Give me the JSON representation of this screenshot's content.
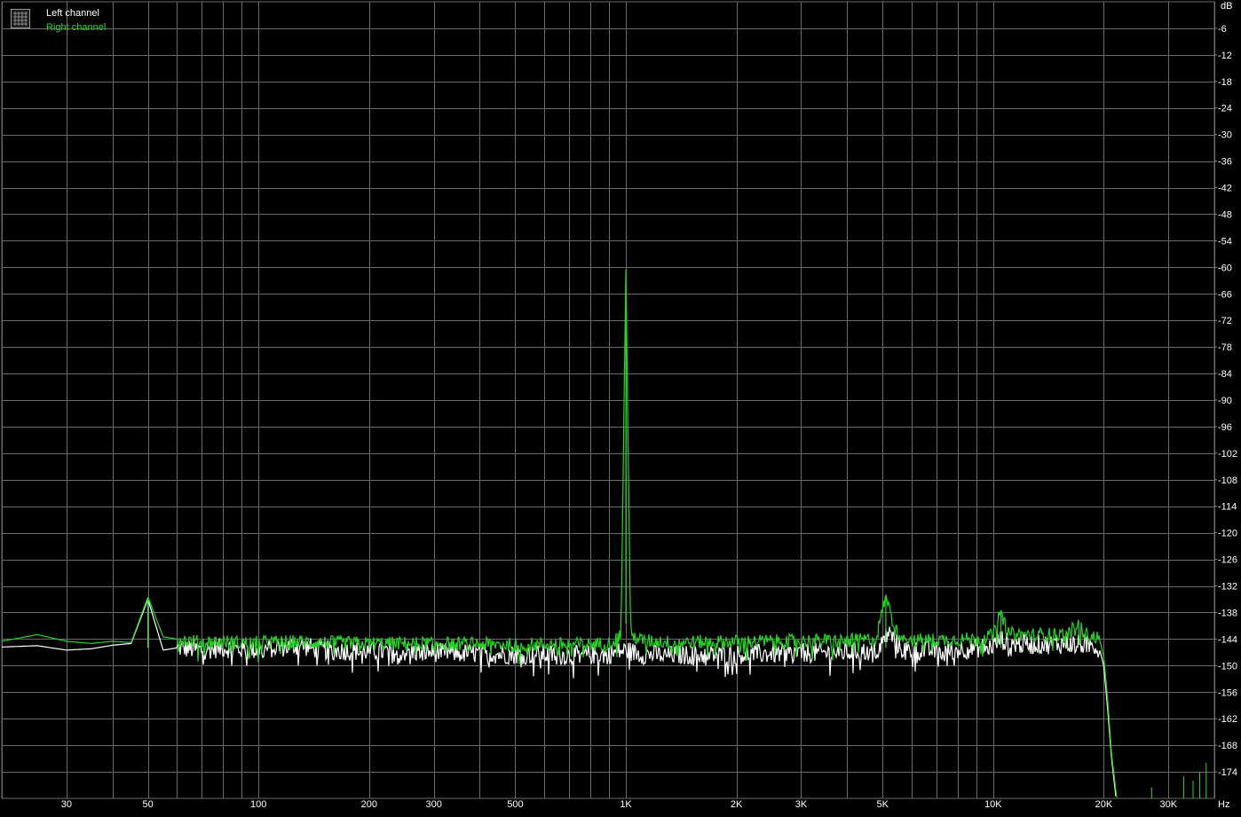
{
  "legend": {
    "icon": "grid-chart-icon",
    "entries": [
      {
        "label": "Left channel",
        "color": "#ffffff"
      },
      {
        "label": "Right channel",
        "color": "#1fd81f"
      }
    ]
  },
  "chart_data": {
    "type": "line",
    "x_scale": "log",
    "xlim": [
      20,
      40000
    ],
    "ylim": [
      -180,
      0
    ],
    "xlabel": "Hz",
    "ylabel": "dB",
    "x_ticks": [
      {
        "value": 30,
        "label": "30"
      },
      {
        "value": 50,
        "label": "50"
      },
      {
        "value": 100,
        "label": "100"
      },
      {
        "value": 200,
        "label": "200"
      },
      {
        "value": 300,
        "label": "300"
      },
      {
        "value": 500,
        "label": "500"
      },
      {
        "value": 1000,
        "label": "1K"
      },
      {
        "value": 2000,
        "label": "2K"
      },
      {
        "value": 3000,
        "label": "3K"
      },
      {
        "value": 5000,
        "label": "5K"
      },
      {
        "value": 10000,
        "label": "10K"
      },
      {
        "value": 20000,
        "label": "20K"
      },
      {
        "value": 30000,
        "label": "30K"
      }
    ],
    "y_ticks": [
      -6,
      -12,
      -18,
      -24,
      -30,
      -36,
      -42,
      -48,
      -54,
      -60,
      -66,
      -72,
      -78,
      -84,
      -90,
      -96,
      -102,
      -108,
      -114,
      -120,
      -126,
      -132,
      -138,
      -144,
      -150,
      -156,
      -162,
      -168,
      -174
    ],
    "grid": true,
    "background": "#000000",
    "grid_color": "#6a6a6a",
    "series": [
      {
        "name": "Left channel",
        "color": "#ffffff",
        "points": [
          [
            20,
            -145.8
          ],
          [
            25,
            -145.5
          ],
          [
            30,
            -146.5
          ],
          [
            35,
            -146.2
          ],
          [
            40,
            -145.4
          ],
          [
            45,
            -145
          ],
          [
            50,
            -135
          ],
          [
            55,
            -146.5
          ],
          [
            60,
            -146
          ],
          [
            70,
            -146.5
          ],
          [
            80,
            -146
          ],
          [
            90,
            -146.3
          ],
          [
            100,
            -146.5
          ],
          [
            110,
            -146
          ],
          [
            130,
            -145.5
          ],
          [
            150,
            -146.5
          ],
          [
            200,
            -146.8
          ],
          [
            300,
            -147
          ],
          [
            400,
            -147.3
          ],
          [
            500,
            -147.5
          ],
          [
            600,
            -147.5
          ],
          [
            700,
            -147.7
          ],
          [
            800,
            -147.6
          ],
          [
            900,
            -147.4
          ],
          [
            1000,
            -146.5
          ],
          [
            1100,
            -147.5
          ],
          [
            1300,
            -147.6
          ],
          [
            1500,
            -147.6
          ],
          [
            2000,
            -147.5
          ],
          [
            2500,
            -147.3
          ],
          [
            3000,
            -147.2
          ],
          [
            4000,
            -147
          ],
          [
            4800,
            -146.7
          ],
          [
            5200,
            -142.5
          ],
          [
            5600,
            -146.2
          ],
          [
            6000,
            -146.6
          ],
          [
            7000,
            -146.6
          ],
          [
            8000,
            -146.4
          ],
          [
            9000,
            -146.1
          ],
          [
            10000,
            -145.5
          ],
          [
            10500,
            -144
          ],
          [
            11000,
            -145
          ],
          [
            12000,
            -145.2
          ],
          [
            14000,
            -145.2
          ],
          [
            16000,
            -145.1
          ],
          [
            18000,
            -145.3
          ],
          [
            19000,
            -145.6
          ],
          [
            19500,
            -146.5
          ],
          [
            20000,
            -150
          ],
          [
            20500,
            -160
          ],
          [
            21000,
            -171
          ],
          [
            21600,
            -180
          ]
        ]
      },
      {
        "name": "Right channel",
        "color": "#1fd81f",
        "points": [
          [
            20,
            -144.5
          ],
          [
            25,
            -143
          ],
          [
            30,
            -144.5
          ],
          [
            35,
            -145
          ],
          [
            40,
            -144.5
          ],
          [
            45,
            -144.8
          ],
          [
            50,
            -134.5
          ],
          [
            55,
            -143.5
          ],
          [
            60,
            -144
          ],
          [
            70,
            -144.8
          ],
          [
            80,
            -144.6
          ],
          [
            90,
            -144.9
          ],
          [
            100,
            -144.8
          ],
          [
            110,
            -144.7
          ],
          [
            130,
            -144.6
          ],
          [
            150,
            -144.8
          ],
          [
            200,
            -145
          ],
          [
            300,
            -145
          ],
          [
            400,
            -145.1
          ],
          [
            500,
            -145.3
          ],
          [
            600,
            -145.2
          ],
          [
            700,
            -145.2
          ],
          [
            800,
            -145.2
          ],
          [
            900,
            -145
          ],
          [
            970,
            -143
          ],
          [
            1000,
            -60.5
          ],
          [
            1030,
            -143
          ],
          [
            1100,
            -144.3
          ],
          [
            1300,
            -144.7
          ],
          [
            1500,
            -144.7
          ],
          [
            2000,
            -144.6
          ],
          [
            2500,
            -144.5
          ],
          [
            3000,
            -144.4
          ],
          [
            4000,
            -144.4
          ],
          [
            4800,
            -144
          ],
          [
            5100,
            -134
          ],
          [
            5400,
            -142
          ],
          [
            6000,
            -144.2
          ],
          [
            7000,
            -144.2
          ],
          [
            8000,
            -144.1
          ],
          [
            9000,
            -144
          ],
          [
            10000,
            -143.2
          ],
          [
            10500,
            -137.5
          ],
          [
            11000,
            -142.8
          ],
          [
            12000,
            -143
          ],
          [
            14000,
            -143
          ],
          [
            16000,
            -142.9
          ],
          [
            17000,
            -140.5
          ],
          [
            18000,
            -143.2
          ],
          [
            19000,
            -143.5
          ],
          [
            19500,
            -144.3
          ],
          [
            20000,
            -148
          ],
          [
            20500,
            -158
          ],
          [
            21000,
            -170
          ],
          [
            21700,
            -180
          ]
        ]
      }
    ],
    "sparse_markers": [
      {
        "x": 33000,
        "y": -175,
        "color": "#1fd81f"
      },
      {
        "x": 35000,
        "y": -176,
        "color": "#1fd81f"
      },
      {
        "x": 36500,
        "y": -174,
        "color": "#1fd81f"
      },
      {
        "x": 38000,
        "y": -172,
        "color": "#1fd81f"
      },
      {
        "x": 27000,
        "y": -177.5,
        "color": "#1fd81f"
      }
    ]
  }
}
